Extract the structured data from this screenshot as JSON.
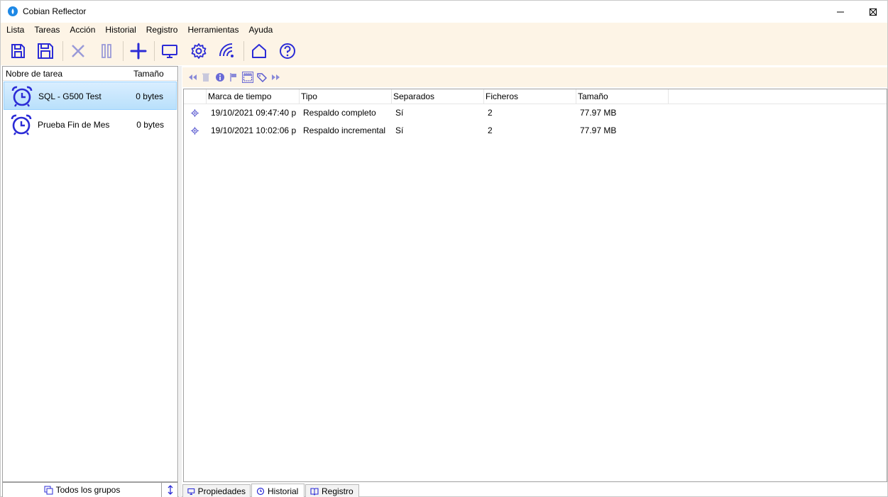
{
  "window": {
    "title": "Cobian Reflector",
    "accent": "#2b2bd6"
  },
  "menu": [
    "Lista",
    "Tareas",
    "Acción",
    "Historial",
    "Registro",
    "Herramientas",
    "Ayuda"
  ],
  "toolbar": {
    "icons": [
      "save-list-icon",
      "save-icon",
      "cancel-icon",
      "pause-icon",
      "add-task-icon",
      "monitor-icon",
      "settings-icon",
      "network-icon",
      "home-icon",
      "help-icon"
    ]
  },
  "tasks": {
    "header_name": "Nobre de tarea",
    "header_size": "Tamaño",
    "items": [
      {
        "name": "SQL - G500 Test",
        "size": "0 bytes",
        "selected": true
      },
      {
        "name": "Prueba Fin de Mes",
        "size": "0 bytes",
        "selected": false
      }
    ],
    "groups_label": "Todos los grupos"
  },
  "history": {
    "columns": [
      "Marca de tiempo",
      "Tipo",
      "Separados",
      "Ficheros",
      "Tamaño"
    ],
    "rows": [
      {
        "timestamp": "19/10/2021 09:47:40 p",
        "type": "Respaldo completo",
        "separated": "Sí",
        "files": "2",
        "size": "77.97 MB"
      },
      {
        "timestamp": "19/10/2021 10:02:06 p",
        "type": "Respaldo incremental",
        "separated": "Sí",
        "files": "2",
        "size": "77.97 MB"
      }
    ]
  },
  "tabs": [
    {
      "label": "Propiedades",
      "active": false
    },
    {
      "label": "Historial",
      "active": true
    },
    {
      "label": "Registro",
      "active": false
    }
  ]
}
